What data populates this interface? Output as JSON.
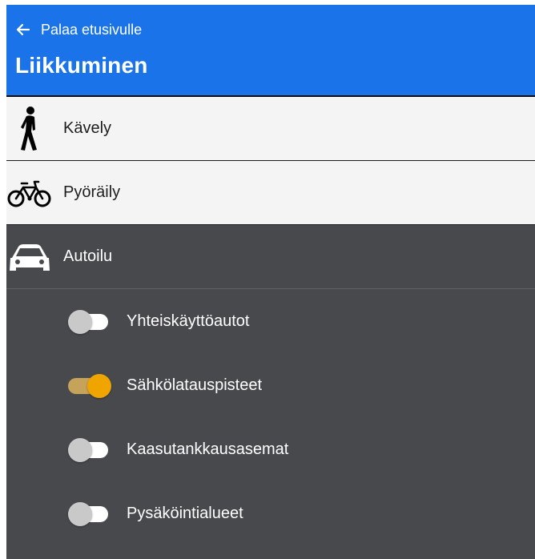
{
  "header": {
    "back_label": "Palaa etusivulle",
    "title": "Liikkuminen",
    "background": "#1a73e8"
  },
  "categories": [
    {
      "label": "Kävely",
      "icon": "walking-person-icon"
    },
    {
      "label": "Pyöräily",
      "icon": "bicycle-icon"
    },
    {
      "label": "Autoilu",
      "icon": "car-icon",
      "expanded": true
    }
  ],
  "layers": [
    {
      "label": "Yhteiskäyttöautot",
      "enabled": false
    },
    {
      "label": "Sähkölatauspisteet",
      "enabled": true
    },
    {
      "label": "Kaasutankkausasemat",
      "enabled": false
    },
    {
      "label": "Pysäköintialueet",
      "enabled": false
    }
  ],
  "colors": {
    "panel_dark": "#48494d",
    "toggle_on_knob": "#f0a400",
    "toggle_on_track": "#c6a35a",
    "toggle_off_knob": "#c9c9c9"
  }
}
